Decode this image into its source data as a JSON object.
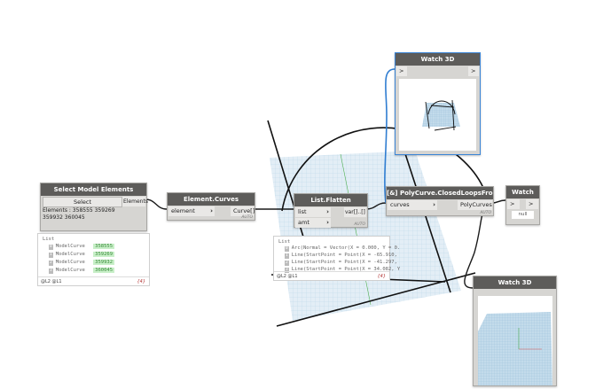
{
  "nodes": {
    "select": {
      "title": "Select Model Elements",
      "button": "Select",
      "output": "Elements",
      "info": "Elements : 358555 359269 359932 360045",
      "preview": {
        "header": "List",
        "items": [
          {
            "index": "0",
            "type": "ModelCurve",
            "id": "358555"
          },
          {
            "index": "1",
            "type": "ModelCurve",
            "id": "359269"
          },
          {
            "index": "2",
            "type": "ModelCurve",
            "id": "359932"
          },
          {
            "index": "3",
            "type": "ModelCurve",
            "id": "360045"
          }
        ],
        "footer": "@L2 @L1",
        "count": "{4}"
      }
    },
    "element_curves": {
      "title": "Element.Curves",
      "input": "element",
      "output": "Curve[]",
      "lacing": "AUTO"
    },
    "list_flatten": {
      "title": "List.Flatten",
      "inputs": [
        "list",
        "amt"
      ],
      "output": "var[]..[]",
      "lacing": "AUTO",
      "preview": {
        "header": "List",
        "items": [
          {
            "index": "0",
            "text": "Arc(Normal = Vector(X = 0.000, Y = 0."
          },
          {
            "index": "1",
            "text": "Line(StartPoint = Point(X = -65.910,"
          },
          {
            "index": "2",
            "text": "Line(StartPoint = Point(X = -41.297,"
          },
          {
            "index": "3",
            "text": "Line(StartPoint = Point(X = 34.082, Y"
          }
        ],
        "footer": "@L2 @L1",
        "count": "{4}"
      }
    },
    "polycurve": {
      "title": "[&] PolyCurve.ClosedLoopsFromCurves",
      "input": "curves",
      "output": "PolyCurves",
      "lacing": "AUTO"
    },
    "watch": {
      "title": "Watch",
      "value": "null",
      "port_in": ">",
      "port_out": ">"
    },
    "watch3d_top": {
      "title": "Watch 3D",
      "port_in": ">",
      "port_out": ">"
    },
    "watch3d_bottom": {
      "title": "Watch 3D"
    }
  },
  "colors": {
    "node_title": "#5d5c5a",
    "node_body": "#d6d5d2",
    "wire": "#1a1a1a",
    "selected_wire": "#2f7dd1",
    "grid": "#9fc3dc"
  }
}
